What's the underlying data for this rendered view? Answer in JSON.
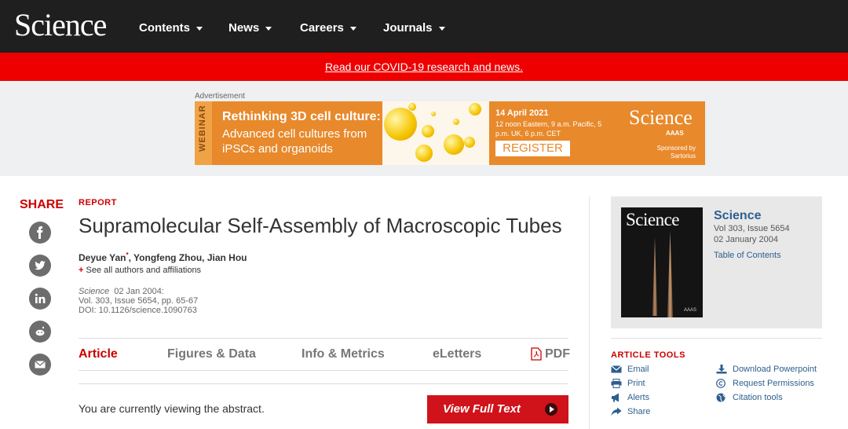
{
  "header": {
    "logo": "Science",
    "nav": [
      {
        "label": "Contents"
      },
      {
        "label": "News"
      },
      {
        "label": "Careers"
      },
      {
        "label": "Journals"
      }
    ]
  },
  "banner": {
    "link_text": "Read our COVID-19 research and news."
  },
  "ad": {
    "label": "Advertisement",
    "vertical_tag": "WEBINAR",
    "headline": "Rethinking 3D cell culture:",
    "subhead": "Advanced cell cultures from iPSCs and organoids",
    "date": "14 April 2021",
    "time": "12 noon Eastern, 9 a.m. Pacific, 5 p.m. UK, 6 p.m. CET",
    "register": "REGISTER",
    "logo": "Science",
    "logo_sub": "AAAS",
    "sponsor": "Sponsored by Sartorius"
  },
  "share": {
    "label": "SHARE",
    "icons": [
      "facebook-icon",
      "twitter-icon",
      "linkedin-icon",
      "reddit-icon",
      "email-icon"
    ]
  },
  "article": {
    "type": "REPORT",
    "title": "Supramolecular Self-Assembly of Macroscopic Tubes",
    "authors": "Deyue Yan",
    "authors_rest": ", Yongfeng Zhou, Jian Hou",
    "author_mark": "*",
    "affiliations": "See all authors and affiliations",
    "journal": "Science",
    "date": "02 Jan 2004:",
    "volume": "Vol. 303, Issue 5654, pp. 65-67",
    "doi": "DOI: 10.1126/science.1090763"
  },
  "tabs": [
    {
      "label": "Article",
      "active": true
    },
    {
      "label": "Figures & Data"
    },
    {
      "label": "Info & Metrics"
    },
    {
      "label": "eLetters"
    },
    {
      "label": "PDF"
    }
  ],
  "viewing": {
    "text": "You are currently viewing the abstract.",
    "button": "View Full Text"
  },
  "issue": {
    "cover_title": "Science",
    "cover_aaas": "AAAS",
    "title": "Science",
    "volume": "Vol 303, Issue 5654",
    "date": "02 January 2004",
    "toc": "Table of Contents"
  },
  "tools": {
    "title": "ARTICLE TOOLS",
    "left": [
      "Email",
      "Print",
      "Alerts",
      "Share"
    ],
    "right": [
      "Download Powerpoint",
      "Request Permissions",
      "Citation tools"
    ]
  },
  "colors": {
    "brand_red": "#cc0000",
    "link_blue": "#2d5f8e",
    "ad_orange": "#e8892b"
  }
}
